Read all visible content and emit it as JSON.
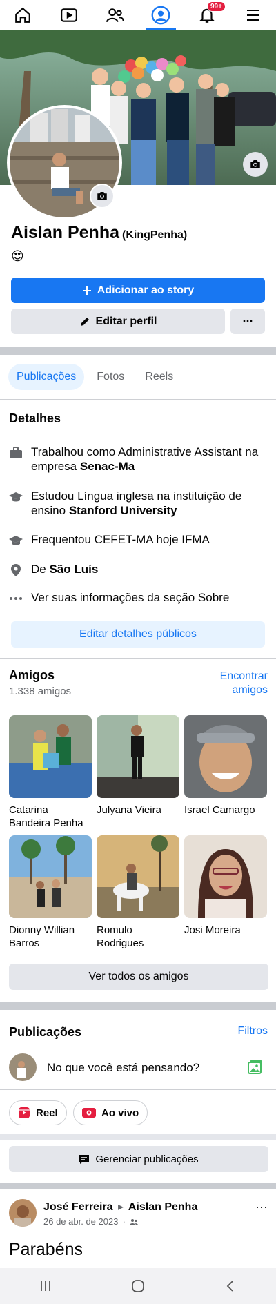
{
  "nav": {
    "items": [
      {
        "icon": "home-icon"
      },
      {
        "icon": "video-icon"
      },
      {
        "icon": "friends-icon"
      },
      {
        "icon": "profile-icon",
        "active": true
      },
      {
        "icon": "bell-icon",
        "badge": "99+"
      },
      {
        "icon": "menu-icon"
      }
    ]
  },
  "profile": {
    "name": "Aislan Penha",
    "alternate_name": "(KingPenha)",
    "emoji": "😍"
  },
  "actions": {
    "add_story": "Adicionar ao story",
    "edit_profile": "Editar perfil",
    "more": "···"
  },
  "tabs": [
    "Publicações",
    "Fotos",
    "Reels"
  ],
  "details": {
    "title": "Detalhes",
    "work_prefix": "Trabalhou como Administrative Assistant na empresa ",
    "work_company": "Senac-Ma",
    "study_prefix": "Estudou Língua inglesa na instituição de ensino ",
    "study_school": "Stanford University",
    "attended": "Frequentou CEFET-MA hoje IFMA",
    "from_prefix": "De ",
    "from_city": "São Luís",
    "see_about": "Ver suas informações da seção Sobre",
    "edit_public": "Editar detalhes públicos"
  },
  "friends": {
    "title": "Amigos",
    "count": "1.338 amigos",
    "find_line1": "Encontrar",
    "find_line2": "amigos",
    "list": [
      {
        "name": "Catarina Bandeira Penha"
      },
      {
        "name": "Julyana Vieira"
      },
      {
        "name": "Israel Camargo"
      },
      {
        "name": "Dionny Willian Barros"
      },
      {
        "name": "Romulo Rodrigues"
      },
      {
        "name": "Josi Moreira"
      }
    ],
    "see_all": "Ver todos os amigos"
  },
  "posts": {
    "title": "Publicações",
    "filters": "Filtros",
    "composer_placeholder": "No que você está pensando?",
    "reel": "Reel",
    "live": "Ao vivo",
    "manage": "Gerenciar publicações"
  },
  "post": {
    "author": "José Ferreira",
    "arrow": "▸",
    "target": "Aislan Penha",
    "date": "26 de abr. de 2023",
    "text": "Parabéns"
  },
  "colors": {
    "accent": "#1877f2",
    "badge": "#e41e3f",
    "light_accent": "#e7f3ff",
    "gray_button": "#e4e6eb"
  }
}
